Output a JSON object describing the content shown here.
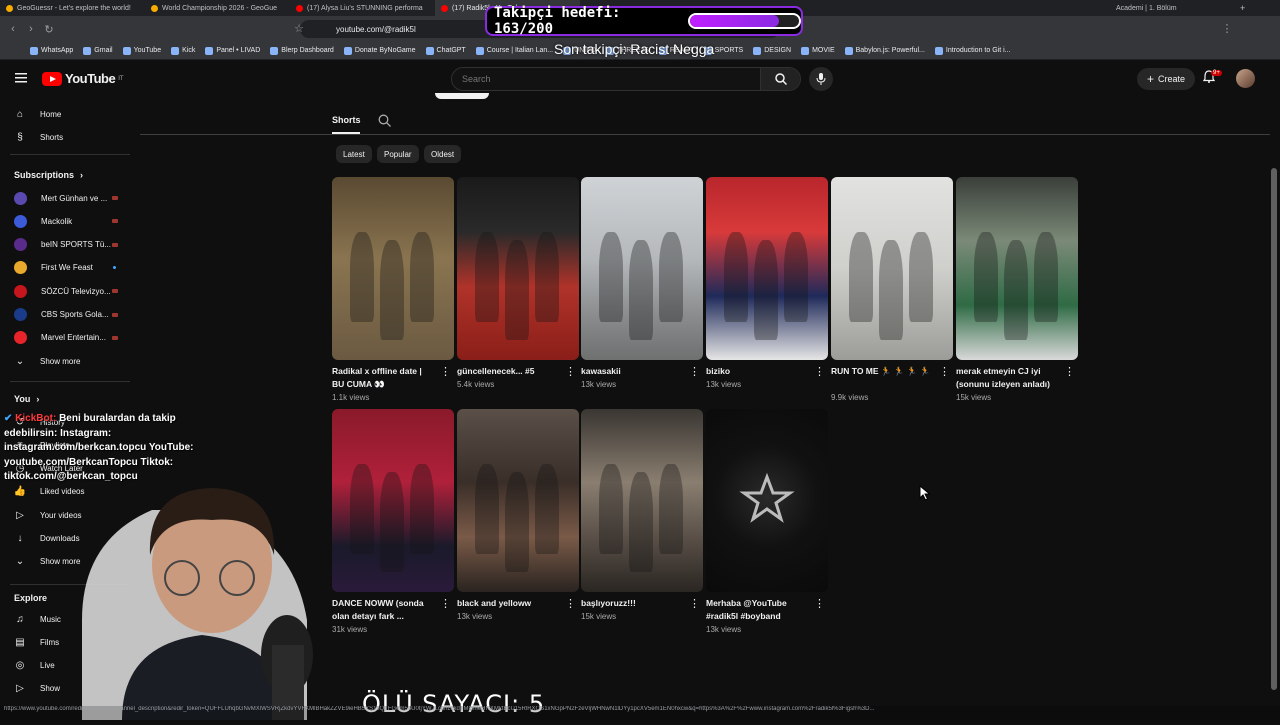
{
  "browser": {
    "tabs": [
      {
        "label": "GeoGuessr - Let's explore the world!",
        "color": "#f9ab00"
      },
      {
        "label": "World Championship 2026 - GeoGue",
        "color": "#f9ab00"
      },
      {
        "label": "(17) Alysa Liu's STUNNING performa",
        "color": "#ff0000"
      },
      {
        "label": "(17) Radik5l - YouTube",
        "color": "#ff0000",
        "active": true
      }
    ],
    "tab_right_label": "Academi | 1. Bölüm",
    "url": "youtube.com/@radik5l",
    "bookmarks": [
      "WhatsApp",
      "Gmail",
      "YouTube",
      "Kick",
      "Panel • LIVAD",
      "Blerp Dashboard",
      "Donate ByNoGame",
      "ChatGPT",
      "Course | Italian Lan...",
      "UNIPD",
      "THREEJS",
      "REACT",
      "SPORTS",
      "DESIGN",
      "MOVIE",
      "Babylon.js: Powerful...",
      "Introduction to Git i..."
    ]
  },
  "overlay": {
    "goal_label": "Takipçi hedefi: 163/200",
    "goal_progress": 0.815,
    "last_follower": "Son takipçi: Racist Negga",
    "counter": "ÖLÜ SAYACI: 5",
    "chat_name": "KickBot:",
    "chat_message": "Beni buralardan da takip edebilirsin: Instagram: instagram.com/berkcan.topcu YouTube: youtube.com/BerkcanTopcu Tiktok: tiktok.com/@berkcan_topcu"
  },
  "youtube": {
    "logo": "YouTube",
    "logo_sup": "IT",
    "search_placeholder": "Search",
    "create_label": "Create",
    "notif_badge": "9+",
    "sidebar": {
      "main": [
        "Home",
        "Shorts"
      ],
      "subscriptions_label": "Subscriptions",
      "subscriptions": [
        {
          "name": "Mert Günhan ve ...",
          "color": "#5a4ab0",
          "live": true
        },
        {
          "name": "Mackolik",
          "color": "#3b5bd8",
          "live": true
        },
        {
          "name": "beIN SPORTS Tü...",
          "color": "#5b2b8c",
          "live": true
        },
        {
          "name": "First We Feast",
          "color": "#e8a92c",
          "live": false
        },
        {
          "name": "SÖZCÜ Televizyo...",
          "color": "#c4161c",
          "live": true
        },
        {
          "name": "CBS Sports Gola...",
          "color": "#1a3a8a",
          "live": true
        },
        {
          "name": "Marvel Entertain...",
          "color": "#e62429",
          "live": true
        }
      ],
      "show_more": "Show more",
      "you_label": "You",
      "you_items": [
        "History",
        "Playlists",
        "Watch Later",
        "Liked videos",
        "Your videos",
        "Downloads",
        "Show more"
      ],
      "explore_label": "Explore",
      "explore_items": [
        "Music",
        "Films",
        "Live",
        "Show"
      ]
    },
    "tab_shorts": "Shorts",
    "chips": [
      "Latest",
      "Popular",
      "Oldest"
    ],
    "shorts": [
      {
        "title": "Radikal x offline date | BU CUMA 👀",
        "views": "1.1k views",
        "bg": "linear-gradient(180deg,#5a4a32 0%,#8a7450 45%,#6b5a42 100%)"
      },
      {
        "title": "güncellenecek... #5",
        "views": "5.4k views",
        "bg": "linear-gradient(180deg,#1a1a1a 0%,#2a2a2a 30%,#b0332a 60%,#8a1e18 100%)"
      },
      {
        "title": "kawasakii",
        "views": "13k views",
        "bg": "linear-gradient(180deg,#cfd3d6 0%,#b4b8bb 45%,#8b8d8e 75%,#6f7070 100%)"
      },
      {
        "title": "biziko",
        "views": "13k views",
        "bg": "linear-gradient(180deg,#b8262c 0%,#d83a3a 30%,#1f2a5a 65%,#e6e6e6 100%)"
      },
      {
        "title": "RUN TO ME 🏃 🏃 🏃 🏃",
        "views": "9.9k views",
        "bg": "linear-gradient(180deg,#e2e2e0 0%,#cfcfcc 50%,#9c9c98 100%)"
      },
      {
        "title": "merak etmeyin CJ iyi (sonunu izleyen anladı)",
        "views": "15k views",
        "bg": "linear-gradient(180deg,#3a3f3a 0%,#7b8a78 35%,#2f6b45 70%,#d9d9d9 100%)"
      },
      {
        "title": "DANCE NOWW (sonda olan detayı fark ...",
        "views": "31k views",
        "bg": "linear-gradient(180deg,#8a1a2a 0%,#b0203a 40%,#1a1a2a 75%,#2a1a3a 100%)"
      },
      {
        "title": "black and yelloww",
        "views": "13k views",
        "bg": "linear-gradient(180deg,#5a5048 0%,#3a2e28 40%,#7a5a48 70%,#2a2420 100%)"
      },
      {
        "title": "başlıyoruzz!!!",
        "views": "15k views",
        "bg": "linear-gradient(180deg,#3a3632 0%,#8a7e70 40%,#5a5048 70%,#2a2622 100%)"
      },
      {
        "title": "Merhaba @YouTube #radik5l #boyband",
        "views": "13k views",
        "bg": "radial-gradient(circle at 50% 48%,#2a2a2a 0%,#111 45%,#0a0a0a 100%)"
      }
    ]
  },
  "statusbar": "https://www.youtube.com/redirect?event=channel_description&redir_token=QUFFLUhqbGNvMXlWSVRjZkdvYVFKMlBHakZZVE9ieHB5YS1sQTFGem54U0tjYWJLcnhzckdTMGhleHNXMktBcU15RlRXOS1xNGpPN2FzeVljWHNwN1lDYy1pcXV5em1EN0hxcw&q=https%3A%2F%2Fwww.instagram.com%2Fradik5l%3Figsh%3D..."
}
